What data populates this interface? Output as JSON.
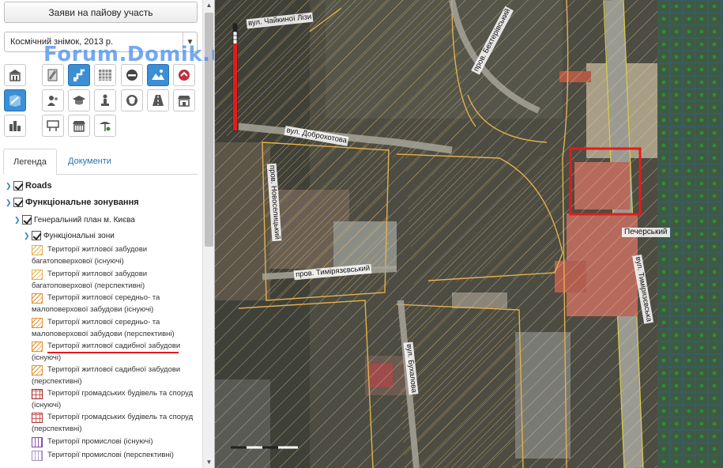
{
  "panel": {
    "apply_button": "Заяви на пайову участь",
    "basemap_select": {
      "value": "Космічний знімок, 2013 р."
    },
    "watermark": "Forum.Domik.ua",
    "tabs": [
      {
        "label": "Легенда",
        "active": true
      },
      {
        "label": "Документи",
        "active": false
      }
    ],
    "tree": {
      "roads": "Roads",
      "zoning": "Функціональне зонування",
      "general_plan": "Генеральний план м. Києва",
      "zones": "Функціональні зони"
    },
    "legend": [
      {
        "line1": "Території житлової забудови",
        "line2": "багатоповерхової (існуючі)",
        "swatch": "hatch-y"
      },
      {
        "line1": "Території житлової забудови",
        "line2": "багатоповерхової (перспективні)",
        "swatch": "hatch-y"
      },
      {
        "line1": "Території житлової середньо- та",
        "line2": "малоповерхової забудови (існуючі)",
        "swatch": "hatch-o"
      },
      {
        "line1": "Території житлової середньо- та",
        "line2": "малоповерхової забудови (перспективні)",
        "swatch": "hatch-o"
      },
      {
        "line1": "Території житлової садибної забудови",
        "line2": "(існуючі)",
        "swatch": "hatch-o"
      },
      {
        "line1": "Території житлової садибної забудови",
        "line2": "(перспективні)",
        "swatch": "hatch-o"
      },
      {
        "line1": "Території громадських будівель та споруд",
        "line2": "(існуючі)",
        "swatch": "grid-r"
      },
      {
        "line1": "Території громадських будівель та споруд",
        "line2": "(перспективні)",
        "swatch": "grid-r2"
      },
      {
        "line1": "Території промислові (існуючі)",
        "line2": "",
        "swatch": "pur"
      },
      {
        "line1": "Території промислові (перспективні)",
        "line2": "",
        "swatch": "pur2"
      }
    ]
  },
  "map": {
    "streets": {
      "chaikinoi": "вул. Чайкиної Лізи",
      "bekhterivskyi": "пров. Бехтерівський",
      "dobrokhotova": "вул. Доброхотова",
      "novoselytskyi": "пров. Новоселицький",
      "tymiriazievskyi": "пров. Тимірязєвський",
      "tymiriazievska": "вул. Тимірязєвська",
      "bukhalova": "вул. Бухалова"
    },
    "place_label": "Печерський"
  },
  "colors": {
    "accent": "#3a8fd6",
    "highlight_red": "#e31b1b",
    "zoning_yellow": "#e3b04b",
    "zoning_green": "#2e8b3a"
  }
}
